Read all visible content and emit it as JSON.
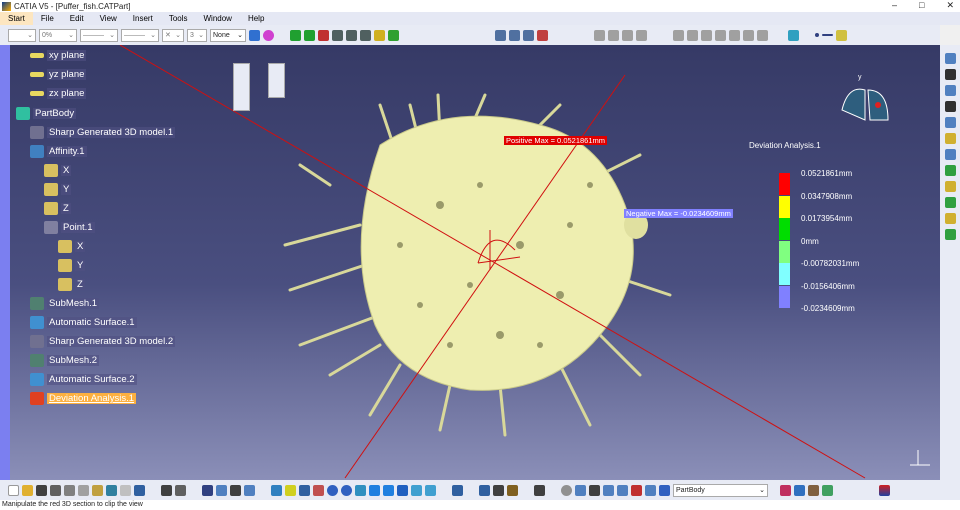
{
  "window": {
    "title": "CATIA V5 - [Puffer_fish.CATPart]",
    "buttons": [
      "–",
      "□",
      "✕"
    ]
  },
  "menu": [
    "Start",
    "File",
    "Edit",
    "View",
    "Insert",
    "Tools",
    "Window",
    "Help"
  ],
  "toolbar": {
    "transparency": "0%",
    "line_weight": "3",
    "layer": "None",
    "current_body": "PartBody"
  },
  "tree": [
    {
      "label": "xy plane",
      "icon": "plane-icon"
    },
    {
      "label": "yz plane",
      "icon": "plane-icon"
    },
    {
      "label": "zx plane",
      "icon": "plane-icon"
    },
    {
      "label": "PartBody",
      "icon": "partbody-icon"
    },
    {
      "label": "Sharp Generated 3D model.1",
      "icon": "cloud-icon"
    },
    {
      "label": "Affinity.1",
      "icon": "affinity-icon"
    },
    {
      "label": "X",
      "icon": "parameter-icon"
    },
    {
      "label": "Y",
      "icon": "parameter-icon"
    },
    {
      "label": "Z",
      "icon": "parameter-icon"
    },
    {
      "label": "Point.1",
      "icon": "point-icon"
    },
    {
      "label": "X",
      "icon": "parameter-icon"
    },
    {
      "label": "Y",
      "icon": "parameter-icon"
    },
    {
      "label": "Z",
      "icon": "parameter-icon"
    },
    {
      "label": "SubMesh.1",
      "icon": "mesh-icon"
    },
    {
      "label": "Automatic Surface.1",
      "icon": "surface-icon"
    },
    {
      "label": "Sharp Generated 3D model.2",
      "icon": "cloud-icon"
    },
    {
      "label": "SubMesh.2",
      "icon": "mesh-icon"
    },
    {
      "label": "Automatic Surface.2",
      "icon": "surface-icon"
    },
    {
      "label": "Deviation Analysis.1",
      "icon": "deviation-icon"
    }
  ],
  "viewport": {
    "positive_max": "Positive Max = 0.0521861mm",
    "negative_max": "Negative Max = -0.0234609mm"
  },
  "legend": {
    "title": "Deviation Analysis.1",
    "values": [
      "0.0521861mm",
      "0.0347908mm",
      "0.0173954mm",
      "0mm",
      "-0.00782031mm",
      "-0.0156406mm",
      "-0.0234609mm"
    ],
    "colors": [
      "#ff0000",
      "#ffff00",
      "#00dd00",
      "#80ff80",
      "#80ffff",
      "#8080ff"
    ]
  },
  "status": "Manipulate the red 3D section to clip the view"
}
